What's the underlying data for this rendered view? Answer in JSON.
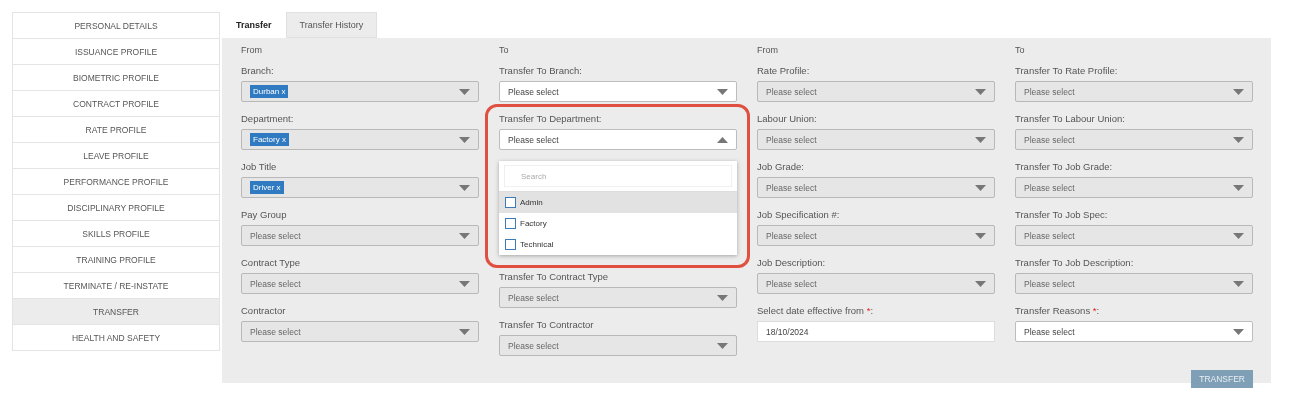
{
  "sidebar": {
    "items": [
      {
        "label": "PERSONAL DETAILS",
        "selected": false
      },
      {
        "label": "ISSUANCE PROFILE",
        "selected": false
      },
      {
        "label": "BIOMETRIC PROFILE",
        "selected": false
      },
      {
        "label": "CONTRACT PROFILE",
        "selected": false
      },
      {
        "label": "RATE PROFILE",
        "selected": false
      },
      {
        "label": "LEAVE PROFILE",
        "selected": false
      },
      {
        "label": "PERFORMANCE PROFILE",
        "selected": false
      },
      {
        "label": "DISCIPLINARY PROFILE",
        "selected": false
      },
      {
        "label": "SKILLS PROFILE",
        "selected": false
      },
      {
        "label": "TRAINING PROFILE",
        "selected": false
      },
      {
        "label": "TERMINATE / RE-INSTATE",
        "selected": false
      },
      {
        "label": "TRANSFER",
        "selected": true
      },
      {
        "label": "HEALTH AND SAFETY",
        "selected": false
      }
    ]
  },
  "tabs": [
    {
      "label": "Transfer",
      "selected": true
    },
    {
      "label": "Transfer History",
      "selected": false
    }
  ],
  "columns": [
    {
      "heading": "From",
      "fields": [
        {
          "kind": "select",
          "label": "Branch:",
          "disabled": true,
          "tags": [
            "Durban x"
          ]
        },
        {
          "kind": "select",
          "label": "Department:",
          "disabled": true,
          "tags": [
            "Factory x"
          ]
        },
        {
          "kind": "select",
          "label": "Job Title",
          "disabled": true,
          "tags": [
            "Driver x"
          ]
        },
        {
          "kind": "select",
          "label": "Pay Group",
          "disabled": true,
          "placeholder": "Please select"
        },
        {
          "kind": "select",
          "label": "Contract Type",
          "disabled": true,
          "placeholder": "Please select"
        },
        {
          "kind": "select",
          "label": "Contractor",
          "disabled": true,
          "placeholder": "Please select"
        }
      ]
    },
    {
      "heading": "To",
      "fields": [
        {
          "kind": "select",
          "label": "Transfer To Branch:",
          "disabled": false,
          "placeholder": "Please select"
        },
        {
          "kind": "select",
          "label": "Transfer To Department:",
          "disabled": false,
          "placeholder": "Please select",
          "open": true,
          "highlighted": true,
          "menu": {
            "search_placeholder": "Search",
            "options": [
              {
                "label": "Admin",
                "checked": false,
                "hovered": true
              },
              {
                "label": "Factory",
                "checked": false,
                "hovered": false
              },
              {
                "label": "Technical",
                "checked": false,
                "hovered": false
              }
            ]
          }
        },
        {
          "kind": "select",
          "label": "Transfer To Contract Type",
          "disabled": true,
          "placeholder": "Please select"
        },
        {
          "kind": "select",
          "label": "Transfer To Contractor",
          "disabled": true,
          "placeholder": "Please select"
        }
      ]
    },
    {
      "heading": "From",
      "fields": [
        {
          "kind": "select",
          "label": "Rate Profile:",
          "disabled": true,
          "placeholder": "Please select"
        },
        {
          "kind": "select",
          "label": "Labour Union:",
          "disabled": true,
          "placeholder": "Please select"
        },
        {
          "kind": "select",
          "label": "Job Grade:",
          "disabled": true,
          "placeholder": "Please select"
        },
        {
          "kind": "select",
          "label": "Job Specification #:",
          "disabled": true,
          "placeholder": "Please select"
        },
        {
          "kind": "select",
          "label": "Job Description:",
          "disabled": true,
          "placeholder": "Please select"
        },
        {
          "kind": "date",
          "label": "Select date effective from ",
          "required_mark": "*",
          "label_end": ":",
          "disabled": false,
          "value": "18/10/2024"
        }
      ]
    },
    {
      "heading": "To",
      "fields": [
        {
          "kind": "select",
          "label": "Transfer To Rate Profile:",
          "disabled": true,
          "placeholder": "Please select"
        },
        {
          "kind": "select",
          "label": "Transfer To Labour Union:",
          "disabled": true,
          "placeholder": "Please select"
        },
        {
          "kind": "select",
          "label": "Transfer To Job Grade:",
          "disabled": true,
          "placeholder": "Please select"
        },
        {
          "kind": "select",
          "label": "Transfer To Job Spec:",
          "disabled": true,
          "placeholder": "Please select"
        },
        {
          "kind": "select",
          "label": "Transfer To Job Description:",
          "disabled": true,
          "placeholder": "Please select"
        },
        {
          "kind": "select",
          "label": "Transfer Reasons ",
          "required_mark": "*",
          "label_end": ":",
          "disabled": false,
          "placeholder": "Please select"
        }
      ]
    }
  ],
  "transfer_button": {
    "label": "TRANSFER",
    "disabled": true
  }
}
